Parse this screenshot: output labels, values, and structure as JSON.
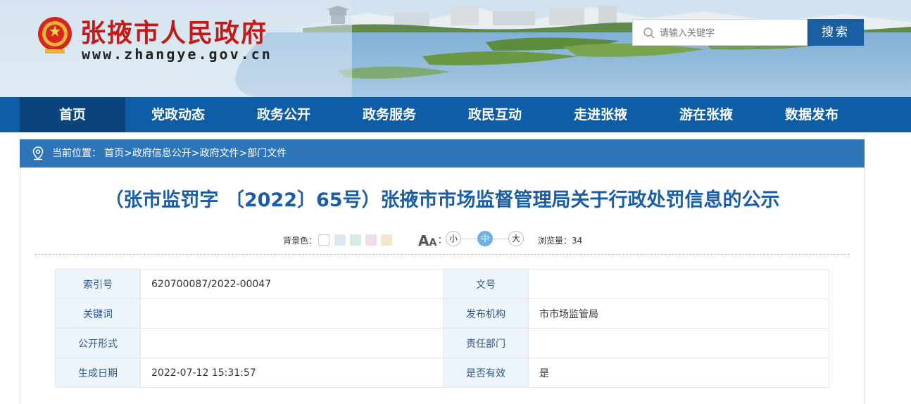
{
  "site": {
    "title": "张掖市人民政府",
    "url": "www.zhangye.gov.cn"
  },
  "search": {
    "placeholder": "请输入关键字",
    "button_label": "搜索"
  },
  "nav": {
    "items": [
      {
        "label": "首页",
        "active": true
      },
      {
        "label": "党政动态"
      },
      {
        "label": "政务公开"
      },
      {
        "label": "政务服务"
      },
      {
        "label": "政民互动"
      },
      {
        "label": "走进张掖"
      },
      {
        "label": "游在张掖"
      },
      {
        "label": "数据发布"
      }
    ]
  },
  "breadcrumb": {
    "label": "当前位置：",
    "items": [
      "首页",
      "政府信息公开",
      "政府文件",
      "部门文件"
    ],
    "separator": ">"
  },
  "document": {
    "title": "（张市监罚字 〔2022〕65号）张掖市市场监督管理局关于行政处罚信息的公示"
  },
  "tools": {
    "bg_label": "背景色：",
    "bg_colors": [
      "#ffffff",
      "#dde8f6",
      "#d6ece1",
      "#f1dcee",
      "#f3e7c9"
    ],
    "font_icon": "font-size-icon",
    "font_colon": "：",
    "sizes": [
      "小",
      "中",
      "大"
    ],
    "active_size": "中",
    "views_label": "浏览量：",
    "views": "34"
  },
  "info": {
    "rows": [
      {
        "k1": "索引号",
        "v1": "620700087/2022-00047",
        "k2": "文号",
        "v2": ""
      },
      {
        "k1": "关键词",
        "v1": "",
        "k2": "发布机构",
        "v2": "市市场监管局"
      },
      {
        "k1": "公开形式",
        "v1": "",
        "k2": "责任部门",
        "v2": ""
      },
      {
        "k1": "生成日期",
        "v1": "2022-07-12 15:31:57",
        "k2": "是否有效",
        "v2": "是"
      }
    ]
  },
  "colors": {
    "nav_bg": "#0f5da7",
    "nav_active": "#0b447c",
    "title_red": "#c41a16",
    "doc_title_blue": "#1b5ea6",
    "crumb_bg": "#2f76b9",
    "search_button": "#1a5fa4"
  }
}
